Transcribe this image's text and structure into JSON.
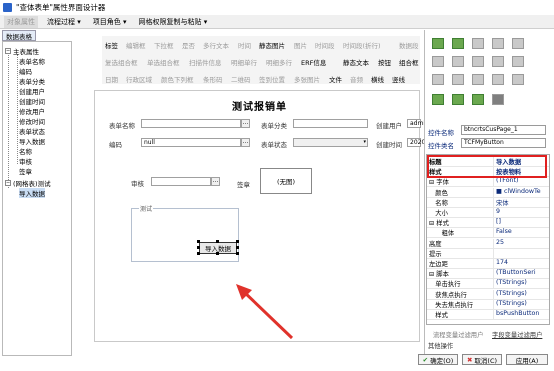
{
  "window": {
    "title": "\"查体表单\"属性界面设计器"
  },
  "toolbar": {
    "items": [
      {
        "label": "对象属性",
        "disabled": true
      },
      {
        "label": "流程过程 ▾",
        "disabled": false
      },
      {
        "label": "项目角色 ▾",
        "disabled": false
      },
      {
        "label": "网格权限复制与粘贴 ▾",
        "disabled": false
      }
    ]
  },
  "left_tab": {
    "label": "数据表格"
  },
  "tree": {
    "root": "主表属性",
    "children": [
      "表单名称",
      "编码",
      "表单分类",
      "创建用户",
      "创建时间",
      "修改用户",
      "修改时间",
      "表单状态",
      "导入数据",
      "名称",
      "审核",
      "签章"
    ],
    "sub_root": "(网格表)测试",
    "sub_children": [
      "导入数据"
    ]
  },
  "controls": {
    "row1": [
      "标签",
      "编辑框",
      "下拉框",
      "是否",
      "多行文本",
      "时间",
      "静态图片",
      "图片",
      "时间段",
      "时间段(折行)",
      "数据段"
    ],
    "row2": [
      "复选组合框",
      "单选组合框",
      "扫描件信息",
      "明细单行",
      "明细多行",
      "ERF信息",
      "静态文本",
      "按钮",
      "组合框"
    ],
    "row3": [
      "日期",
      "行政区域",
      "颜色下列框",
      "条形码",
      "二维码",
      "签到位置",
      "多张图片",
      "文件",
      "音频",
      "横线",
      "竖线"
    ],
    "enabled": [
      "标签",
      "静态图片",
      "ERF信息",
      "静态文本",
      "按钮",
      "组合框",
      "文件",
      "横线",
      "竖线"
    ]
  },
  "form": {
    "title": "测试报销单",
    "fields": {
      "name_label": "表单名称",
      "category_label": "表单分类",
      "creator_label": "创建用户",
      "creator_value": "admi",
      "code_label": "编码",
      "code_value": "null",
      "status_label": "表单状态",
      "created_label": "创建时间",
      "created_value": "2020",
      "review_label": "审核",
      "sign_label": "签章",
      "pic_text": "(无图)",
      "group_label": "测试",
      "import_button": "导入数据"
    }
  },
  "right": {
    "control_name_label": "控件名称",
    "control_name_value": "btncrtsCusPage_1",
    "control_class_label": "控件类名",
    "control_class_value": "TCFMyButton",
    "props": [
      {
        "k": "标题",
        "v": "导入数据"
      },
      {
        "k": "样式",
        "v": "按表物料"
      },
      {
        "k": "⊟ 字体",
        "v": "(TFont)"
      },
      {
        "k": "　颜色",
        "v": "■ clWindowTe"
      },
      {
        "k": "　名称",
        "v": "宋体"
      },
      {
        "k": "　大小",
        "v": "9"
      },
      {
        "k": "⊟ 样式",
        "v": "[]"
      },
      {
        "k": "　　粗体",
        "v": "False"
      },
      {
        "k": "高度",
        "v": "25"
      },
      {
        "k": "提示",
        "v": ""
      },
      {
        "k": "左边距",
        "v": "174"
      },
      {
        "k": "⊟ 脚本",
        "v": "(TButtonSeri"
      },
      {
        "k": "　单击执行",
        "v": "(TStrings)"
      },
      {
        "k": "　获焦点执行",
        "v": "(TStrings)"
      },
      {
        "k": "　失去焦点执行",
        "v": "(TStrings)"
      },
      {
        "k": "　样式",
        "v": "bsPushButton"
      }
    ],
    "tabs": [
      "流程变量过滤用户",
      "字段变量过滤用户"
    ],
    "other": "其他操作"
  },
  "buttons": {
    "ok": "确定(O)",
    "cancel": "取消(C)",
    "apply": "应用(A)"
  },
  "colors": {
    "highlight": "#e02020",
    "arrow": "#e0322b",
    "accent": "#2a63c9"
  }
}
